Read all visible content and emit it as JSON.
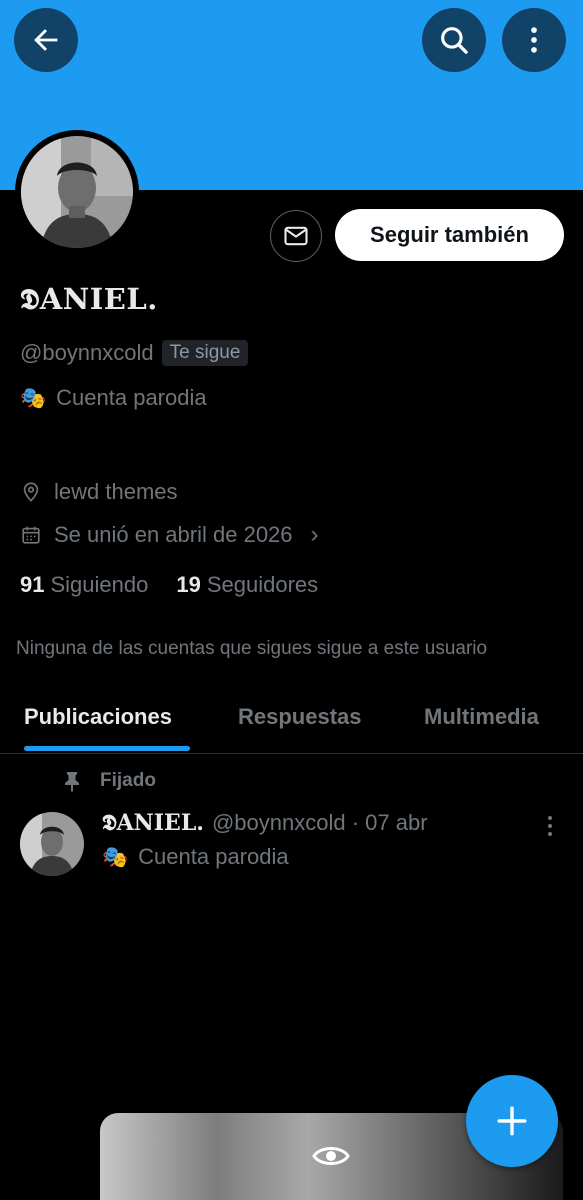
{
  "header": {
    "back_icon": "back-arrow-icon",
    "search_icon": "search-icon",
    "more_icon": "more-vertical-icon",
    "banner_color": "#1d9bf0"
  },
  "profile": {
    "name": "𝕯ANIEL.",
    "handle": "@boynnxcold",
    "follows_you_badge": "Te sigue",
    "parody_label": "Cuenta parodia",
    "location": "lewd themes",
    "joined": "Se unió en abril de 2026",
    "following_count": "91",
    "following_label": "Siguiendo",
    "followers_count": "19",
    "followers_label": "Seguidores",
    "mutuals_note": "Ninguna de las cuentas que sigues sigue a este usuario"
  },
  "actions": {
    "message_icon": "envelope-icon",
    "follow_back_label": "Seguir también"
  },
  "tabs": [
    {
      "label": "Publicaciones",
      "active": true
    },
    {
      "label": "Respuestas",
      "active": false
    },
    {
      "label": "Multimedia",
      "active": false
    }
  ],
  "pinned_post": {
    "pinned_label": "Fijado",
    "author_name": "𝕯ANIEL.",
    "meta": "@boynnxcold · 07 abr",
    "body": "Cuenta parodia"
  },
  "fab": {
    "icon": "plus-icon",
    "color": "#1d9bf0"
  },
  "accent_color": "#1d9bf0"
}
